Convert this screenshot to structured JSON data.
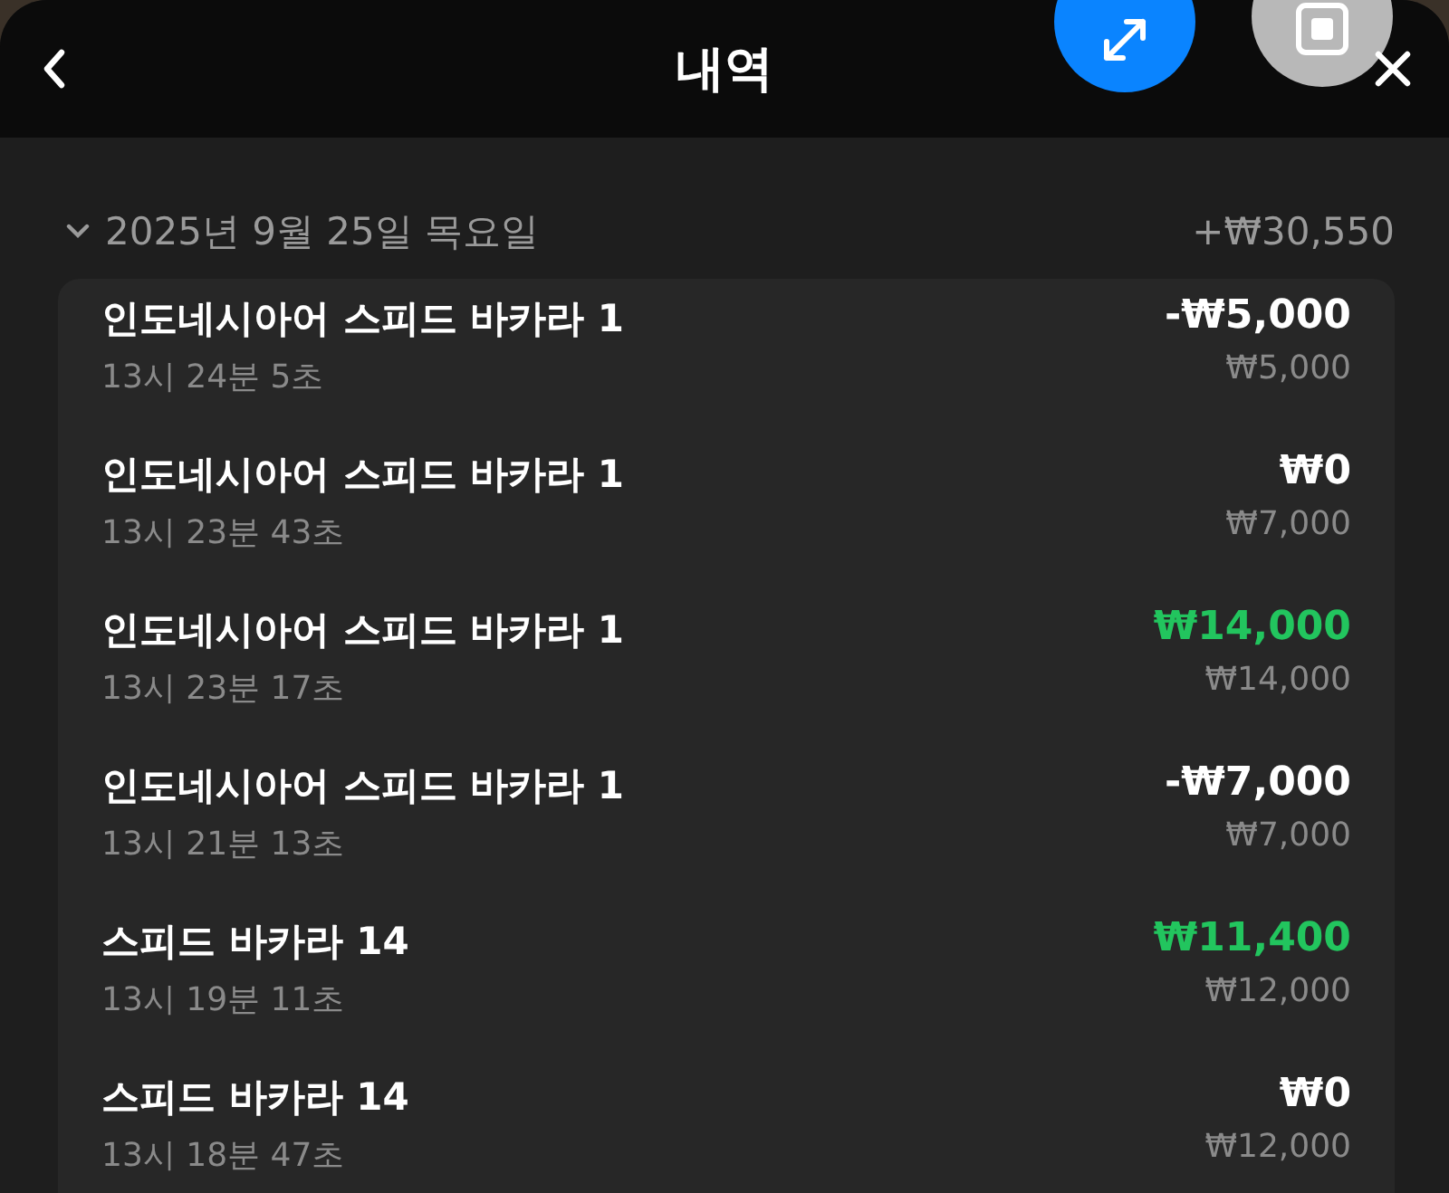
{
  "header": {
    "title": "내역"
  },
  "date_group": {
    "date": "2025년 9월 25일 목요일",
    "total": "+₩30,550",
    "expanded": true
  },
  "transactions": [
    {
      "game": "인도네시아어 스피드 바카라 1",
      "time": "13시 24분 5초",
      "result": "-₩5,000",
      "stake": "₩5,000",
      "win": false
    },
    {
      "game": "인도네시아어 스피드 바카라 1",
      "time": "13시 23분 43초",
      "result": "₩0",
      "stake": "₩7,000",
      "win": false
    },
    {
      "game": "인도네시아어 스피드 바카라 1",
      "time": "13시 23분 17초",
      "result": "₩14,000",
      "stake": "₩14,000",
      "win": true
    },
    {
      "game": "인도네시아어 스피드 바카라 1",
      "time": "13시 21분 13초",
      "result": "-₩7,000",
      "stake": "₩7,000",
      "win": false
    },
    {
      "game": "스피드 바카라 14",
      "time": "13시 19분 11초",
      "result": "₩11,400",
      "stake": "₩12,000",
      "win": true
    },
    {
      "game": "스피드 바카라 14",
      "time": "13시 18분 47초",
      "result": "₩0",
      "stake": "₩12,000",
      "win": false
    }
  ]
}
